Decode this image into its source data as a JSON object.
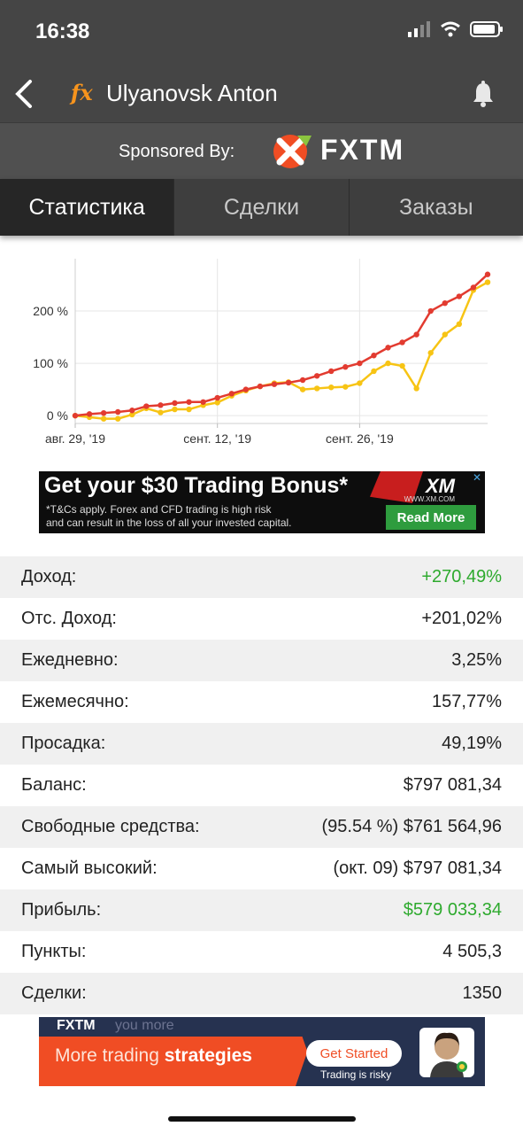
{
  "status_bar": {
    "time": "16:38"
  },
  "header": {
    "fx_badge": "fx",
    "title": "Ulyanovsk Anton"
  },
  "sponsor": {
    "label": "Sponsored By:",
    "brand": "FXTM"
  },
  "tabs": [
    {
      "label": "Статистика",
      "active": true
    },
    {
      "label": "Сделки",
      "active": false
    },
    {
      "label": "Заказы",
      "active": false
    }
  ],
  "chart_data": {
    "type": "line",
    "y_tick_labels": [
      "0 %",
      "100 %",
      "200 %"
    ],
    "y_ticks": [
      0,
      100,
      200
    ],
    "ylim": [
      -15,
      300
    ],
    "x_tick_labels": [
      "авг. 29, '19",
      "сент. 12, '19",
      "сент. 26, '19"
    ],
    "x_tick_index": [
      0,
      10,
      20
    ],
    "grid": true,
    "series": [
      {
        "color": "#e23b30",
        "values": [
          0,
          3,
          5,
          7,
          10,
          18,
          20,
          24,
          26,
          26,
          34,
          42,
          50,
          56,
          60,
          63,
          68,
          76,
          85,
          93,
          100,
          115,
          130,
          140,
          155,
          200,
          215,
          228,
          245,
          270
        ]
      },
      {
        "color": "#f7c414",
        "values": [
          0,
          -3,
          -6,
          -6,
          2,
          14,
          6,
          12,
          12,
          20,
          25,
          38,
          48,
          56,
          62,
          64,
          50,
          52,
          54,
          55,
          62,
          85,
          100,
          95,
          52,
          120,
          155,
          175,
          240,
          255
        ]
      }
    ]
  },
  "ad_top": {
    "headline": "Get your $30 Trading Bonus*",
    "fine_print_1": "*T&Cs apply. Forex and CFD trading is high risk",
    "fine_print_2": "and can result in the loss of all your invested capital.",
    "logo": "XM",
    "url": "WWW.XM.COM",
    "button": "Read More"
  },
  "stats": [
    {
      "label": "Доход:",
      "value": "+270,49%",
      "highlight": true
    },
    {
      "label": "Отс. Доход:",
      "value": "+201,02%",
      "highlight": false
    },
    {
      "label": "Ежедневно:",
      "value": "3,25%",
      "highlight": false
    },
    {
      "label": "Ежемесячно:",
      "value": "157,77%",
      "highlight": false
    },
    {
      "label": "Просадка:",
      "value": "49,19%",
      "highlight": false
    },
    {
      "label": "Баланс:",
      "value": "$797 081,34",
      "highlight": false
    },
    {
      "label": "Свободные средства:",
      "value": "(95.54 %) $761 564,96",
      "highlight": false
    },
    {
      "label": "Самый высокий:",
      "value": "(окт. 09) $797 081,34",
      "highlight": false
    },
    {
      "label": "Прибыль:",
      "value": "$579 033,34",
      "highlight": true
    },
    {
      "label": "Пункты:",
      "value": "4 505,3",
      "highlight": false
    },
    {
      "label": "Сделки:",
      "value": "1350",
      "highlight": false
    }
  ],
  "ad_bottom": {
    "brand": "FXTM",
    "teaser": "you more",
    "headline_light": "More trading",
    "headline_bold": "strategies",
    "button": "Get Started",
    "risk": "Trading is risky"
  },
  "colors": {
    "bar_bg": "#454545",
    "tab_active": "#262626",
    "positive": "#2eaa2e",
    "brand_orange": "#f04d24"
  }
}
